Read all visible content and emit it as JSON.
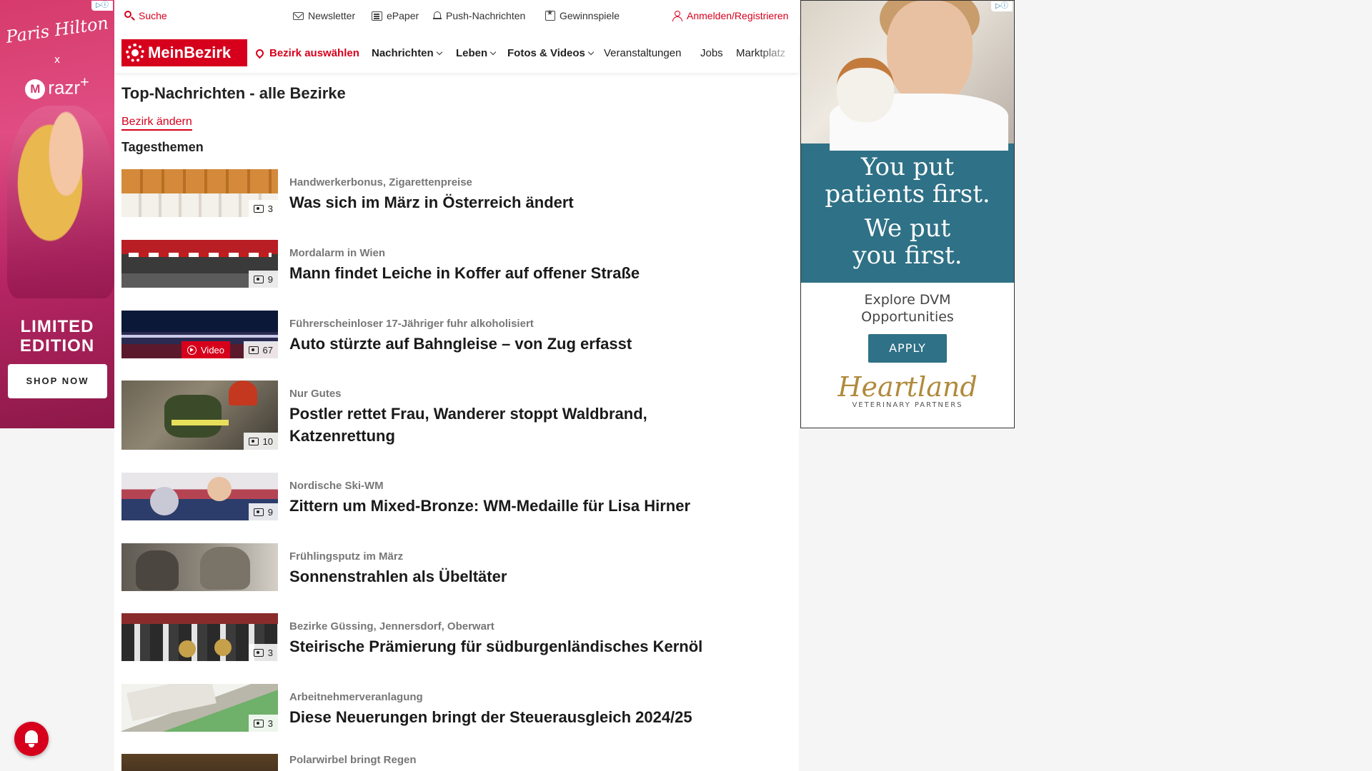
{
  "ads": {
    "left": {
      "brand_script": "Paris Hilton",
      "x": "x",
      "razr": "razr",
      "razr_plus": "+",
      "limited": "LIMITED EDITION",
      "cta": "SHOP NOW"
    },
    "right": {
      "line1": "You put",
      "line2": "patients first.",
      "line3": "We put",
      "line4": "you first.",
      "explore1": "Explore DVM",
      "explore2": "Opportunities",
      "cta": "APPLY",
      "brand": "Heartland",
      "brand_sub": "VETERINARY PARTNERS"
    }
  },
  "topbar": {
    "search": "Suche",
    "newsletter": "Newsletter",
    "epaper": "ePaper",
    "push": "Push-Nachrichten",
    "games": "Gewinnspiele",
    "login": "Anmelden/Registrieren"
  },
  "nav": {
    "logo": "MeinBezirk",
    "bezirk": "Bezirk auswählen",
    "items": [
      "Nachrichten",
      "Leben",
      "Fotos & Videos",
      "Veranstaltungen",
      "Jobs",
      "Marktplatz"
    ]
  },
  "page": {
    "title": "Top-Nachrichten - alle Bezirke",
    "change_link": "Bezirk ändern",
    "section": "Tagesthemen"
  },
  "articles": [
    {
      "kicker": "Handwerkerbonus, Zigarettenpreise",
      "headline": "Was sich im März in Österreich ändert",
      "photos": "3"
    },
    {
      "kicker": "Mordalarm in Wien",
      "headline": "Mann findet Leiche in Koffer auf offener Straße",
      "photos": "9"
    },
    {
      "kicker": "Führerscheinloser 17-Jähriger fuhr alkoholisiert",
      "headline": "Auto stürzte auf Bahngleise – von Zug erfasst",
      "photos": "67",
      "video": "Video"
    },
    {
      "kicker": "Nur Gutes",
      "headline": "Postler rettet Frau, Wanderer stoppt Waldbrand, Katzenrettung",
      "photos": "10"
    },
    {
      "kicker": "Nordische Ski-WM",
      "headline": "Zittern um Mixed-Bronze: WM-Medaille für Lisa Hirner",
      "photos": "9"
    },
    {
      "kicker": "Frühlingsputz im März",
      "headline": "Sonnenstrahlen als Übeltäter",
      "photos": ""
    },
    {
      "kicker": "Bezirke Güssing, Jennersdorf, Oberwart",
      "headline": "Steirische Prämierung für südburgenländisches Kernöl",
      "photos": "3"
    },
    {
      "kicker": "Arbeitnehmerveranlagung",
      "headline": "Diese Neuerungen bringt der Steuerausgleich 2024/25",
      "photos": "3"
    },
    {
      "kicker": "Polarwirbel bringt Regen",
      "headline": "",
      "photos": ""
    }
  ],
  "colors": {
    "brand_red": "#d6001c",
    "ad_teal": "#2f7186"
  }
}
